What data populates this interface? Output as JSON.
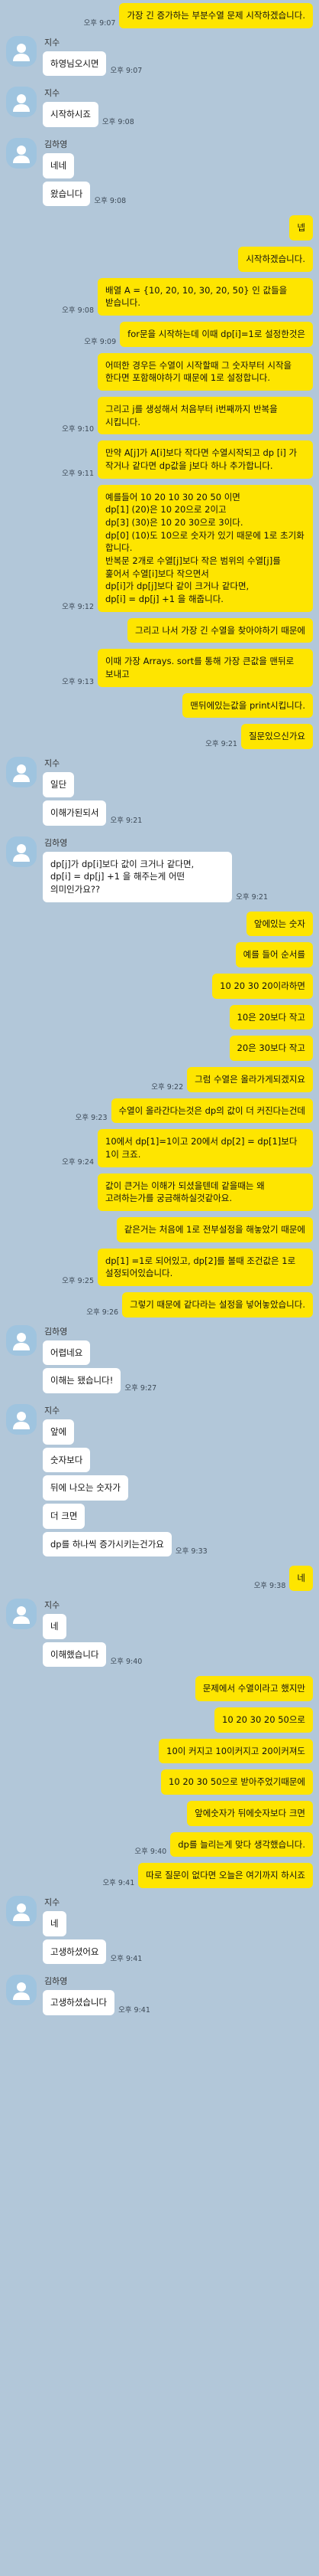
{
  "messages": [
    {
      "from": "me",
      "text": "가장 긴 증가하는 부분수열 문제 시작하겠습니다.",
      "time": "오후 9:07"
    },
    {
      "from": "other",
      "sender": "지수",
      "text": "하영님오시면",
      "time": "오후 9:07"
    },
    {
      "from": "other",
      "sender": "지수",
      "text": "시작하시죠",
      "time": "오후 9:08"
    },
    {
      "from": "other",
      "sender": "김하영",
      "lines": [
        "네네",
        "왔습니다"
      ],
      "time": "오후 9:08"
    },
    {
      "from": "me",
      "text": "넵",
      "time": ""
    },
    {
      "from": "me",
      "text": "시작하겠습니다.",
      "time": ""
    },
    {
      "from": "me",
      "text": "배열 A = {10, 20, 10, 30, 20, 50} 인 값들을 받습니다.",
      "time": "오후 9:08"
    },
    {
      "from": "me",
      "text": "for문을 시작하는데 이때 dp[i]=1로 설정한것은",
      "time": "오후 9:09"
    },
    {
      "from": "me",
      "text": "어떠한 경우든 수열이 시작할때 그 숫자부터 시작을 한다면 포함해야하기 때문에 1로 설정합니다.",
      "time": ""
    },
    {
      "from": "me",
      "text": "그리고 j를 생성해서 처음부터 i번째까지 반복을 시킵니다.",
      "time": "오후 9:10"
    },
    {
      "from": "me",
      "text": "만약 A[j]가 A[i]보다 작다면 수열시작되고 dp [i] 가 작거나 같다면 dp값을 j보다 하나 추가합니다.",
      "time": "오후 9:11"
    },
    {
      "from": "me",
      "text": "예를들어 10 20 10 30 20 50 이면\ndp[1] (20)은 10 20으로 2이고\ndp[3] (30)은 10 20 30으로 3이다.\ndp[0] (10)도 10으로 숫자가 있기 때문에 1로 초기화 합니다.\n반복문 2개로 수열[j]보다 작은 범위의 수열[j]를 훑어서 수열[i]보다 작으면서\ndp[i]가 dp[j]보다 같이 크거나 같다면,\ndp[i] = dp[j] +1 을 해줍니다.",
      "time": "오후 9:12"
    },
    {
      "from": "me",
      "text": "그리고 나서 가장 긴 수열을 찾아야하기 때문에",
      "time": ""
    },
    {
      "from": "me",
      "text": "이때 가장 Arrays. sort를 통해 가장 큰값을 맨뒤로 보내고",
      "time": "오후 9:13"
    },
    {
      "from": "me",
      "text": "맨뒤에있는값을 print시킵니다.",
      "time": ""
    },
    {
      "from": "me",
      "text": "질문있으신가요",
      "time": "오후 9:21"
    },
    {
      "from": "other",
      "sender": "지수",
      "lines": [
        "일단",
        "이해가된되서"
      ],
      "time": "오후 9:21"
    },
    {
      "from": "other",
      "sender": "김하영",
      "text": "dp[j]가 dp[i]보다 값이 크거나 같다면,\ndp[i] = dp[j] +1 을 해주는게 어떤 의미인가요??",
      "time": "오후 9:21"
    },
    {
      "from": "me",
      "text": "앞에있는 숫자",
      "time": ""
    },
    {
      "from": "me",
      "text": "예를 들어 순서를",
      "time": ""
    },
    {
      "from": "me",
      "text": "10 20 30 20이라하면",
      "time": ""
    },
    {
      "from": "me",
      "text": "10은 20보다 작고",
      "time": ""
    },
    {
      "from": "me",
      "text": "20은 30보다 작고",
      "time": ""
    },
    {
      "from": "me",
      "text": "그럼 수열은 올라가게되겠지요",
      "time": "오후 9:22"
    },
    {
      "from": "me",
      "text": "수열이 올라간다는것은 dp의 값이 더 커진다는건데",
      "time": "오후 9:23"
    },
    {
      "from": "me",
      "text": "10에서 dp[1]=1이고 20에서 dp[2] = dp[1]보다 1이 크죠.",
      "time": "오후 9:24"
    },
    {
      "from": "me",
      "text": "값이 큰거는 이해가 되셨을텐데 같을때는 왜 고려하는가를 궁금해하실것같아요.",
      "time": ""
    },
    {
      "from": "me",
      "text": "같은거는 처음에 1로 전부설정을 해놓았기 때문에",
      "time": ""
    },
    {
      "from": "me",
      "text": "dp[1] =1로 되어있고, dp[2]를 볼때 조건값은 1로 설정되어있습니다.",
      "time": "오후 9:25"
    },
    {
      "from": "me",
      "text": "그렇기 때문에 같다라는 설정을 넣어놓았습니다.",
      "time": "오후 9:26"
    },
    {
      "from": "other",
      "sender": "김하영",
      "lines": [
        "어렵네요",
        "이해는 됐습니다!"
      ],
      "time": "오후 9:27"
    },
    {
      "from": "other",
      "sender": "지수",
      "lines": [
        "앞에",
        "숫자보다",
        "뒤에 나오는 숫자가",
        "더 크면",
        "dp를 하나씩 증가시키는건가요"
      ],
      "time": "오후 9:33"
    },
    {
      "from": "me",
      "text": "네",
      "time": "오후 9:38"
    },
    {
      "from": "other",
      "sender": "지수",
      "lines": [
        "네",
        "이해했습니다"
      ],
      "time": "오후 9:40"
    },
    {
      "from": "me",
      "text": "문제에서 수열이라고 했지만",
      "time": ""
    },
    {
      "from": "me",
      "text": "10 20 30 20 50으로",
      "time": ""
    },
    {
      "from": "me",
      "text": "10이 커지고 10이커지고 20이커져도",
      "time": ""
    },
    {
      "from": "me",
      "text": "10 20 30 50으로 받아주었기때문에",
      "time": ""
    },
    {
      "from": "me",
      "text": "앞에숫자가 뒤에숫자보다 크면",
      "time": ""
    },
    {
      "from": "me",
      "text": "dp를 늘리는게 맞다 생각했습니다.",
      "time": "오후 9:40"
    },
    {
      "from": "me",
      "text": "따로 질문이 없다면 오늘은 여기까지 하시죠",
      "time": "오후 9:41"
    },
    {
      "from": "other",
      "sender": "지수",
      "lines": [
        "네",
        "고생하셨어요"
      ],
      "time": "오후 9:41"
    },
    {
      "from": "other",
      "sender": "김하영",
      "lines": [
        "고생하셨습니다"
      ],
      "time": "오후 9:41"
    }
  ]
}
